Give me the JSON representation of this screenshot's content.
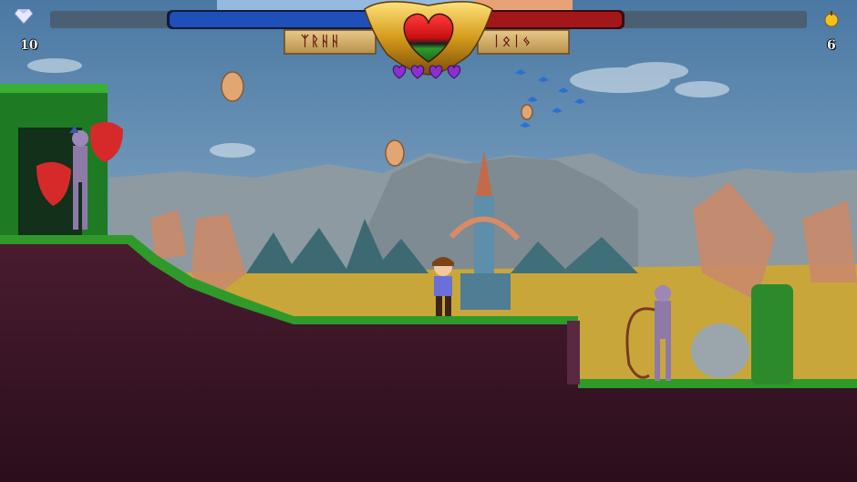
{
  "hud": {
    "gems": {
      "icon": "diamond-icon",
      "count": "10"
    },
    "fruit": {
      "icon": "apple-icon",
      "count": "6"
    },
    "left_banner_text": "ᛉᚱᚺᚺ",
    "right_banner_text": "ᛁᛟᛁᛃ",
    "lives_icon": "purple-heart-icon",
    "lives": 4,
    "center_emblem": "ornate-heart-emblem",
    "player_bar": {
      "color": "#1f4fb8",
      "fill": 1.0
    },
    "enemy_bar": {
      "color": "#a3171a",
      "fill": 1.0
    }
  },
  "colors": {
    "sky_top": "#4f7fa8",
    "sky_bottom": "#8fb2cc",
    "grass": "#2f9a2a",
    "dirt": "#3a1426"
  }
}
